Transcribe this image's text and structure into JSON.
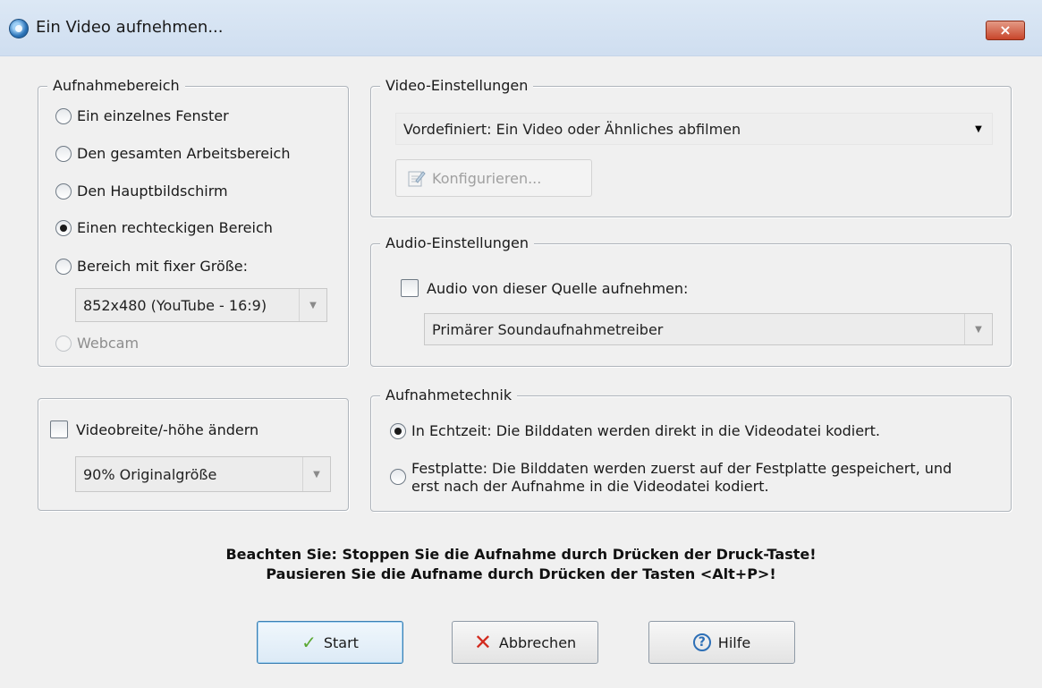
{
  "window": {
    "title": "Ein Video aufnehmen...",
    "close_label": "×"
  },
  "aufnahmebereich": {
    "legend": "Aufnahmebereich",
    "options": [
      {
        "label": "Ein einzelnes Fenster",
        "selected": false,
        "disabled": false
      },
      {
        "label": "Den gesamten Arbeitsbereich",
        "selected": false,
        "disabled": false
      },
      {
        "label": "Den Hauptbildschirm",
        "selected": false,
        "disabled": false
      },
      {
        "label": "Einen rechteckigen Bereich",
        "selected": true,
        "disabled": false
      },
      {
        "label": "Bereich mit fixer Größe:",
        "selected": false,
        "disabled": false
      }
    ],
    "fixed_size_value": "852x480 (YouTube - 16:9)",
    "webcam_label": "Webcam"
  },
  "resize": {
    "checkbox_label": "Videobreite/-höhe ändern",
    "checked": false,
    "value": "90% Originalgröße"
  },
  "video": {
    "legend": "Video-Einstellungen",
    "preset_value": "Vordefiniert: Ein Video oder Ähnliches abfilmen",
    "configure_label": "Konfigurieren..."
  },
  "audio": {
    "legend": "Audio-Einstellungen",
    "checkbox_label": "Audio von dieser Quelle aufnehmen:",
    "checked": false,
    "source_value": "Primärer Soundaufnahmetreiber"
  },
  "technik": {
    "legend": "Aufnahmetechnik",
    "options": [
      {
        "label": "In Echtzeit: Die Bilddaten werden direkt in die Videodatei kodiert.",
        "selected": true
      },
      {
        "label_line1": "Festplatte: Die Bilddaten werden zuerst auf der Festplatte gespeichert, und",
        "label_line2": "erst nach der Aufnahme in die Videodatei kodiert.",
        "selected": false
      }
    ]
  },
  "notice": {
    "line1": "Beachten Sie: Stoppen Sie die Aufnahme durch Drücken der Druck-Taste!",
    "line2": "Pausieren Sie die Aufname durch Drücken der Tasten <Alt+P>!"
  },
  "buttons": {
    "start": "Start",
    "cancel": "Abbrechen",
    "help": "Hilfe"
  },
  "colors": {
    "start_check": "#5aa832",
    "cancel_x": "#d22a1e",
    "help_circle": "#2d6fb6"
  }
}
